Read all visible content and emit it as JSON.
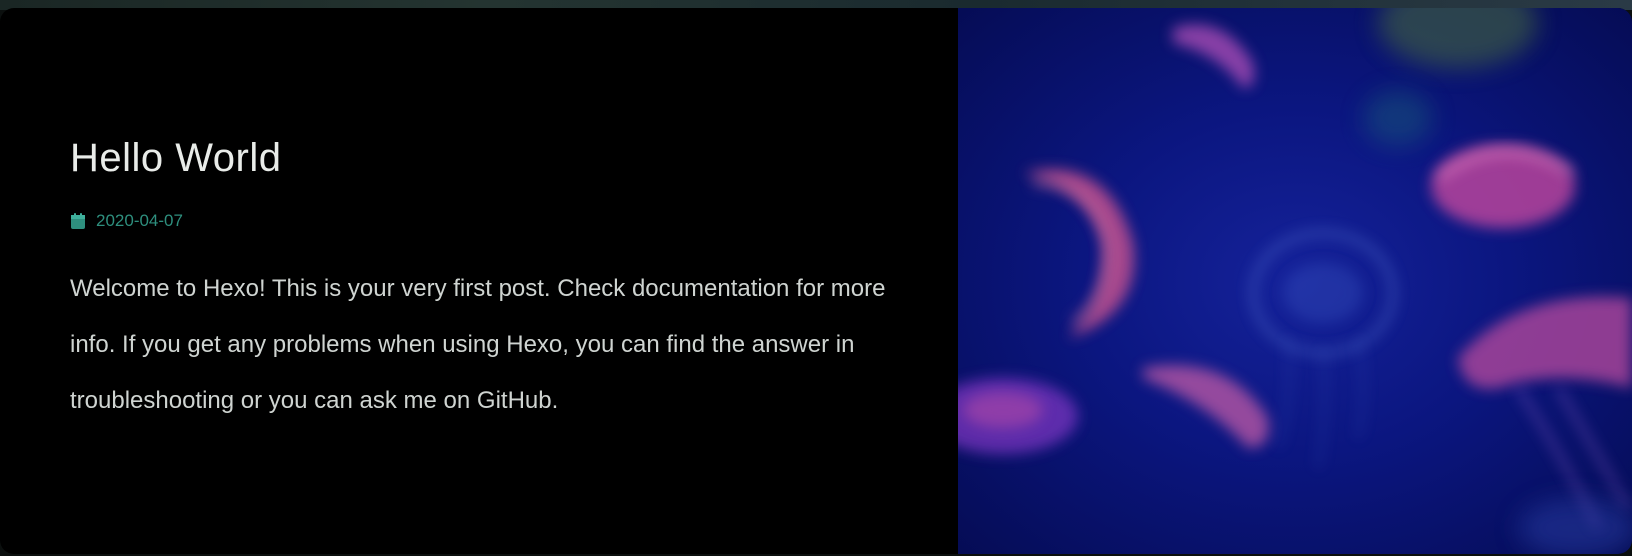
{
  "post": {
    "title": "Hello World",
    "date": "2020-04-07",
    "abstract": "Welcome to Hexo! This is your very first post. Check documentation for more info. If you get any problems when using Hexo, you can find the answer in troubleshooting or you can ask me on GitHub.",
    "feature_image_icon": "jellyfish-image",
    "date_icon": "calendar-icon"
  },
  "colors": {
    "card_background": "#000000",
    "title": "#e9ece9",
    "date_accent": "#2e8f7e",
    "abstract": "#cfd4d1",
    "image_base": "#0b1680"
  }
}
